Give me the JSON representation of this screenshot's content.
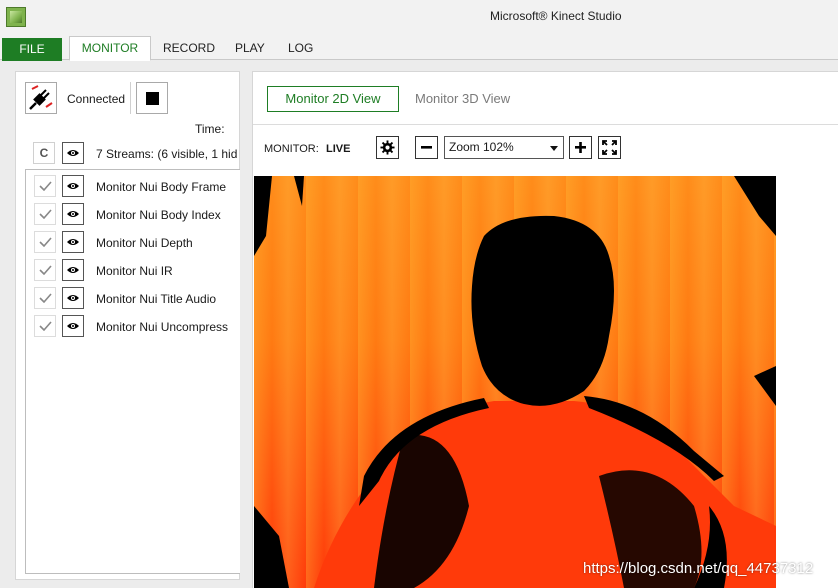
{
  "window": {
    "title": "Microsoft® Kinect Studio"
  },
  "menu": {
    "tabs": [
      {
        "label": "FILE"
      },
      {
        "label": "MONITOR"
      },
      {
        "label": "RECORD"
      },
      {
        "label": "PLAY"
      },
      {
        "label": "LOG"
      }
    ],
    "active_tab": "MONITOR"
  },
  "connection": {
    "status_label": "Connected",
    "time_label": "Time:"
  },
  "streams": {
    "clear_label": "C",
    "summary": "7 Streams: (6 visible, 1 hid",
    "items": [
      {
        "name": "Monitor Nui Body Frame",
        "checked": true,
        "visible": true
      },
      {
        "name": "Monitor Nui Body Index",
        "checked": true,
        "visible": true
      },
      {
        "name": "Monitor Nui Depth",
        "checked": true,
        "visible": true
      },
      {
        "name": "Monitor Nui IR",
        "checked": true,
        "visible": true
      },
      {
        "name": "Monitor Nui Title Audio",
        "checked": true,
        "visible": true
      },
      {
        "name": "Monitor Nui Uncompress",
        "checked": true,
        "visible": true
      }
    ]
  },
  "view_tabs": {
    "view_2d_label": "Monitor 2D View",
    "view_3d_label": "Monitor 3D View",
    "active": "Monitor 2D View"
  },
  "toolbar": {
    "monitor_label": "MONITOR:",
    "live_label": "LIVE",
    "zoom_value": "Zoom 102%"
  },
  "watermark": "https://blog.csdn.net/qq_44737312",
  "colors": {
    "accent": "#1e7d24",
    "depth_orange": "#ff7a12",
    "depth_red": "#ff3a0a"
  },
  "icons": [
    "kinect-plug-icon",
    "stop-icon",
    "eye-icon",
    "checkmark-icon",
    "gear-icon",
    "minus-icon",
    "plus-icon",
    "fullscreen-icon"
  ]
}
